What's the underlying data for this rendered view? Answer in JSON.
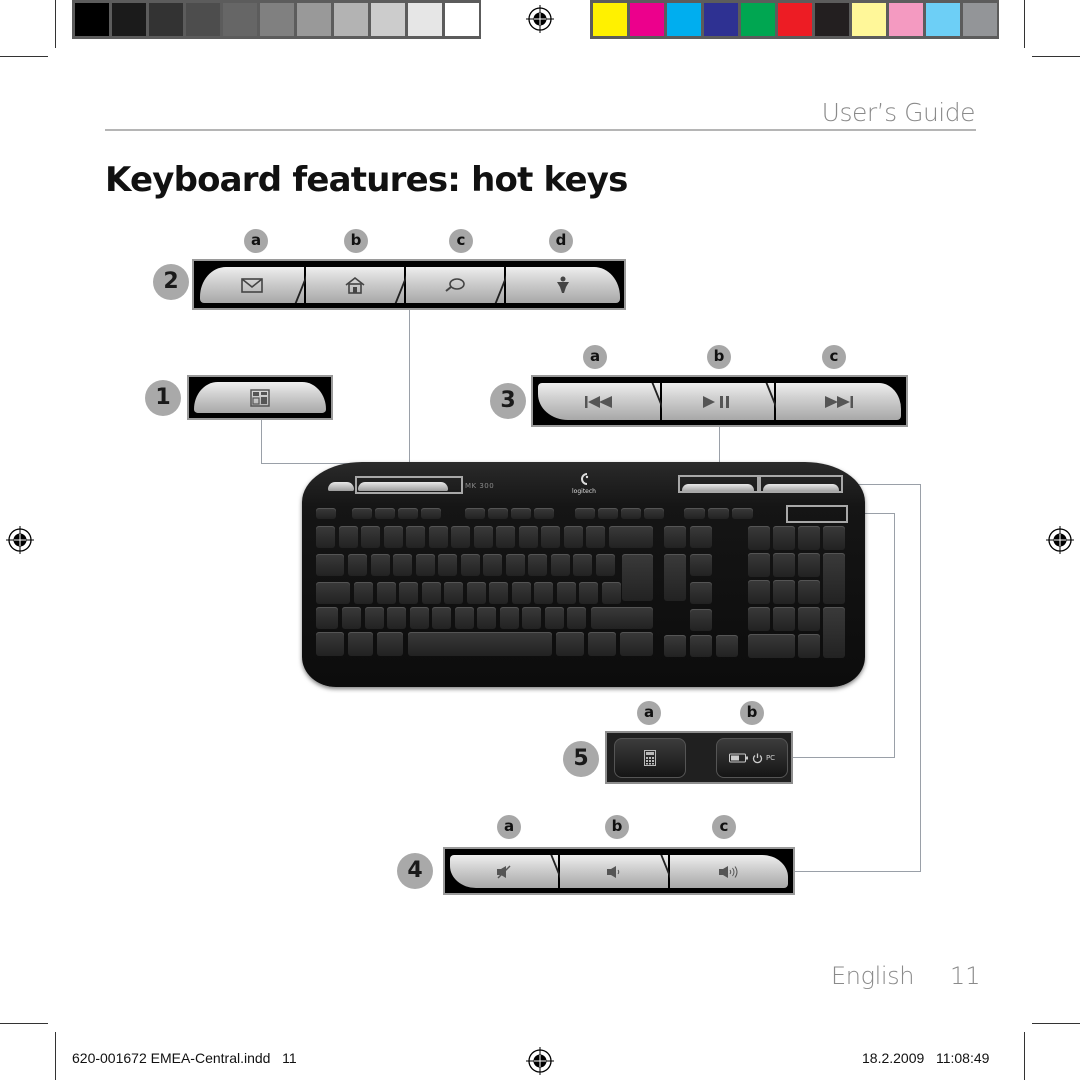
{
  "colorbar_left": {
    "swatches": [
      "#000000",
      "#1b1b1b",
      "#333333",
      "#4d4d4d",
      "#666666",
      "#808080",
      "#999999",
      "#b3b3b3",
      "#cccccc",
      "#e6e6e6",
      "#ffffff"
    ]
  },
  "colorbar_right": {
    "swatches": [
      "#fff100",
      "#ec008c",
      "#00aeef",
      "#2e3192",
      "#00a651",
      "#ed1c24",
      "#231f20",
      "#fff799",
      "#f49ac1",
      "#6dcff6",
      "#939598"
    ]
  },
  "header": {
    "guide_title": "User’s Guide",
    "page_title": "Keyboard features: hot keys"
  },
  "groups": {
    "g1": {
      "number": "1",
      "keys": [
        {
          "icon": "media-center-icon",
          "label": ""
        }
      ]
    },
    "g2": {
      "number": "2",
      "letters": [
        "a",
        "b",
        "c",
        "d"
      ],
      "keys": [
        {
          "icon": "email-icon",
          "label": "a"
        },
        {
          "icon": "home-icon",
          "label": "b"
        },
        {
          "icon": "search-icon",
          "label": "c"
        },
        {
          "icon": "favorites-icon",
          "label": "d"
        }
      ]
    },
    "g3": {
      "number": "3",
      "letters": [
        "a",
        "b",
        "c"
      ],
      "keys": [
        {
          "icon": "previous-track-icon",
          "glyph": "⏮"
        },
        {
          "icon": "play-pause-icon",
          "glyph": "▶❙❙"
        },
        {
          "icon": "next-track-icon",
          "glyph": "⏭"
        }
      ]
    },
    "g4": {
      "number": "4",
      "letters": [
        "a",
        "b",
        "c"
      ],
      "keys": [
        {
          "icon": "mute-icon"
        },
        {
          "icon": "volume-down-icon"
        },
        {
          "icon": "volume-up-icon"
        }
      ]
    },
    "g5": {
      "number": "5",
      "letters": [
        "a",
        "b"
      ],
      "keys": [
        {
          "icon": "calculator-icon"
        },
        {
          "icon": "battery-status-icon",
          "suffix": "PC"
        }
      ]
    }
  },
  "keyboard": {
    "model": "MK 300",
    "brand": "logitech"
  },
  "footer": {
    "language": "English",
    "page_number": "11",
    "slug_file": "620-001672 EMEA-Central.indd   11",
    "slug_datetime": "18.2.2009   11:08:49"
  }
}
